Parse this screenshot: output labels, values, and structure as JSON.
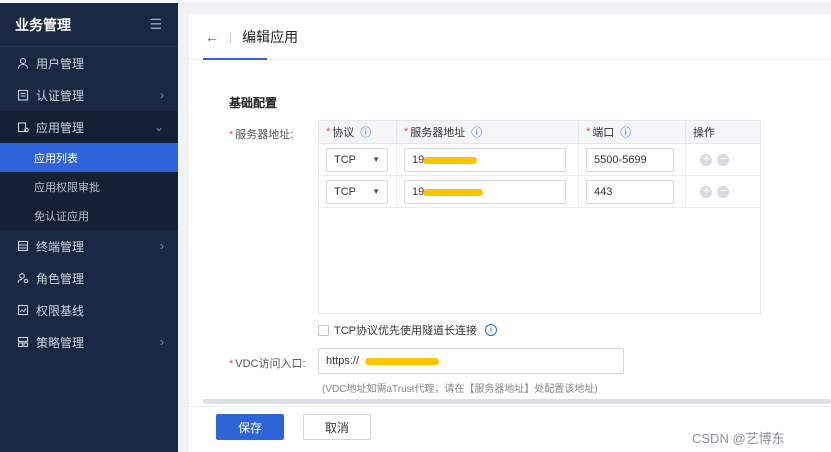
{
  "sidebar": {
    "title": "业务管理",
    "toggle_icon": "menu-fold-icon",
    "items": [
      {
        "label": "用户管理",
        "icon": "user-icon"
      },
      {
        "label": "认证管理",
        "icon": "certificate-icon"
      },
      {
        "label": "应用管理",
        "icon": "app-icon"
      },
      {
        "label": "终端管理",
        "icon": "terminal-icon"
      },
      {
        "label": "角色管理",
        "icon": "role-icon"
      },
      {
        "label": "权限基线",
        "icon": "baseline-icon"
      },
      {
        "label": "策略管理",
        "icon": "policy-icon"
      }
    ],
    "subitems": [
      {
        "label": "应用列表"
      },
      {
        "label": "应用权限审批"
      },
      {
        "label": "免认证应用"
      }
    ]
  },
  "header": {
    "back_icon": "arrow-left-icon",
    "separator": "|",
    "title": "编辑应用"
  },
  "form": {
    "section_title": "基础配置",
    "server_label": "服务器地址:",
    "columns": [
      "协议",
      "服务器地址",
      "端口",
      "操作"
    ],
    "rows": [
      {
        "protocol": "TCP",
        "address": "19",
        "port": "5500-5699"
      },
      {
        "protocol": "TCP",
        "address": "19",
        "port": "443"
      }
    ],
    "tunnel_checkbox_label": "TCP协议优先使用隧道长连接",
    "vdc_label": "VDC访问入口:",
    "vdc_value": "https://",
    "vdc_hint": "(VDC地址如需aTrust代理，请在【服务器地址】处配置该地址)"
  },
  "footer": {
    "save_label": "保存",
    "cancel_label": "取消"
  },
  "watermark": "CSDN @艺博东",
  "colors": {
    "accent": "#2f64d8",
    "sidebar_bg": "#1a2942",
    "redaction": "#ffc400",
    "required": "#e5484d"
  }
}
